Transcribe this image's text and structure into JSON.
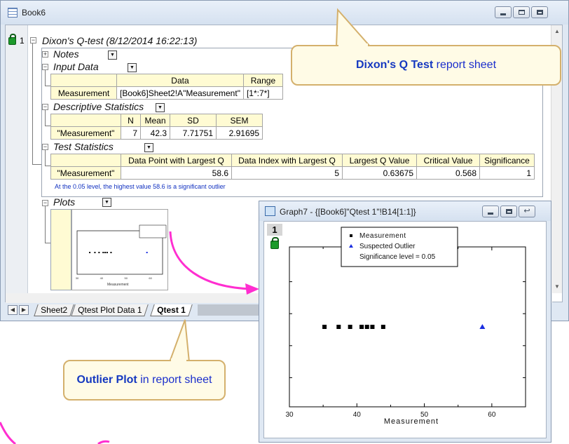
{
  "book": {
    "title": "Book6",
    "row_number": "1",
    "report_title": "Dixon's Q-test (8/12/2014 16:22:13)",
    "sections": {
      "notes": "Notes",
      "input_data": "Input Data",
      "descriptive": "Descriptive Statistics",
      "test_stats": "Test Statistics",
      "plots": "Plots"
    },
    "input_table": {
      "headers": [
        "Data",
        "Range"
      ],
      "row_label": "Measurement",
      "cells": [
        "[Book6]Sheet2!A\"Measurement\"",
        "[1*:7*]"
      ]
    },
    "desc_table": {
      "headers": [
        "N",
        "Mean",
        "SD",
        "SEM"
      ],
      "row_label": "\"Measurement\"",
      "cells": [
        "7",
        "42.3",
        "7.71751",
        "2.91695"
      ]
    },
    "test_table": {
      "headers": [
        "Data Point with Largest Q",
        "Data Index with Largest Q",
        "Largest Q Value",
        "Critical Value",
        "Significance"
      ],
      "row_label": "\"Measurement\"",
      "cells": [
        "58.6",
        "5",
        "0.63675",
        "0.568",
        "1"
      ]
    },
    "footnote": "At the 0.05 level, the highest value 58.6 is a significant outlier",
    "tabs": [
      "Sheet2",
      "Qtest Plot Data 1",
      "Qtest 1"
    ],
    "active_tab": "Qtest 1"
  },
  "callouts": {
    "q_test_bold": "Dixon's Q Test",
    "q_test_rest": " report sheet",
    "outlier_bold": "Outlier Plot",
    "outlier_rest": " in report sheet"
  },
  "graph": {
    "title": "Graph7 - {[Book6]\"Qtest 1\"!B14[1:1]}",
    "layer": "1"
  },
  "colors": {
    "accent_blue": "#1538c0",
    "arrow_magenta": "#ff2ed0",
    "callout_border": "#d4b06c",
    "outlier_marker": "#1a2ee0"
  },
  "chart_data": {
    "type": "scatter",
    "xlabel": "Measurement",
    "ylabel": "",
    "xlim": [
      30,
      65
    ],
    "xticks": [
      30,
      40,
      50,
      60
    ],
    "series": [
      {
        "name": "Measurement",
        "marker": "square",
        "x": [
          35.2,
          37.3,
          39.0,
          40.7,
          41.5,
          42.3,
          43.9
        ],
        "y": [
          1,
          1,
          1,
          1,
          1,
          1,
          1
        ]
      },
      {
        "name": "Suspected Outlier",
        "marker": "triangle",
        "x": [
          58.6
        ],
        "y": [
          1
        ]
      }
    ],
    "legend_note": "Significance level = 0.05",
    "legend_position": "top"
  }
}
